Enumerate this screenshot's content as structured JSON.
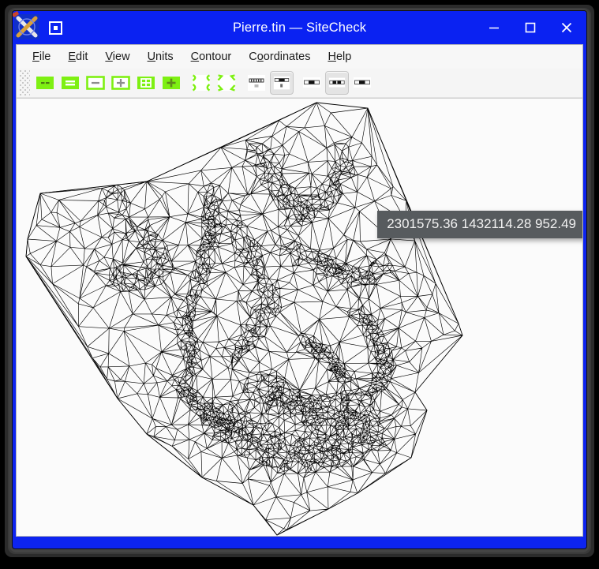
{
  "window": {
    "title": "Pierre.tin — SiteCheck",
    "document_name": "Pierre.tin",
    "app_name": "SiteCheck",
    "accent_color": "#0d24f0",
    "titlebar_text_color": "#ffffff",
    "icon_name": "sitecheck-logo-icon",
    "controls": {
      "window_menu": "window-menu-button",
      "minimize": "minimize-button",
      "maximize": "maximize-button",
      "close": "close-button"
    }
  },
  "menubar": {
    "items": [
      {
        "label": "File",
        "mnemonic": "F"
      },
      {
        "label": "Edit",
        "mnemonic": "E"
      },
      {
        "label": "View",
        "mnemonic": "V"
      },
      {
        "label": "Units",
        "mnemonic": "U"
      },
      {
        "label": "Contour",
        "mnemonic": "C"
      },
      {
        "label": "Coordinates",
        "mnemonic": "o"
      },
      {
        "label": "Help",
        "mnemonic": "H"
      }
    ]
  },
  "toolbar": {
    "grip": "toolbar-grip",
    "buttons": [
      {
        "name": "zoom-out-2x-button",
        "icon": "minus-minus-icon",
        "style": "green-fill",
        "checked": false
      },
      {
        "name": "zoom-out-button",
        "icon": "double-bar-icon",
        "style": "green-fill",
        "checked": false
      },
      {
        "name": "zoom-fit-button",
        "icon": "minus-icon",
        "style": "green-outline",
        "checked": false
      },
      {
        "name": "zoom-in-button",
        "icon": "plus-icon",
        "style": "green-outline",
        "checked": false
      },
      {
        "name": "grid-button",
        "icon": "grid-icon",
        "style": "green-fill",
        "checked": false
      },
      {
        "name": "zoom-in-2x-button",
        "icon": "plus-bold-icon",
        "style": "green-fill",
        "checked": false
      },
      {
        "name": "contour-smooth-button",
        "icon": "curve-corner-icon",
        "style": "curve",
        "checked": false
      },
      {
        "name": "contour-rough-button",
        "icon": "curve-corner-alt-icon",
        "style": "curve",
        "checked": false
      },
      {
        "name": "units-meter-button",
        "icon": "ruler-meter-icon",
        "style": "ruler",
        "checked": false,
        "unit_label": "m"
      },
      {
        "name": "units-foot-button",
        "icon": "ruler-foot-icon",
        "style": "ruler",
        "checked": true,
        "unit_label": "ft"
      },
      {
        "name": "precision-low-button",
        "icon": "precision-1-icon",
        "style": "bar",
        "checked": false
      },
      {
        "name": "precision-medium-button",
        "icon": "precision-2-icon",
        "style": "bar",
        "checked": true
      },
      {
        "name": "precision-high-button",
        "icon": "precision-3-icon",
        "style": "bar",
        "checked": false
      }
    ]
  },
  "canvas": {
    "name": "tin-viewport",
    "background": "#fbfbfb",
    "line_color": "#000000",
    "model": "triangulated-irregular-network"
  },
  "coordinate_readout": {
    "text": "2301575.36 1432114.28 952.49",
    "easting": "2301575.36",
    "northing": "1432114.28",
    "elevation": "952.49",
    "background": "#575b5e",
    "text_color": "#f2f2f2"
  }
}
